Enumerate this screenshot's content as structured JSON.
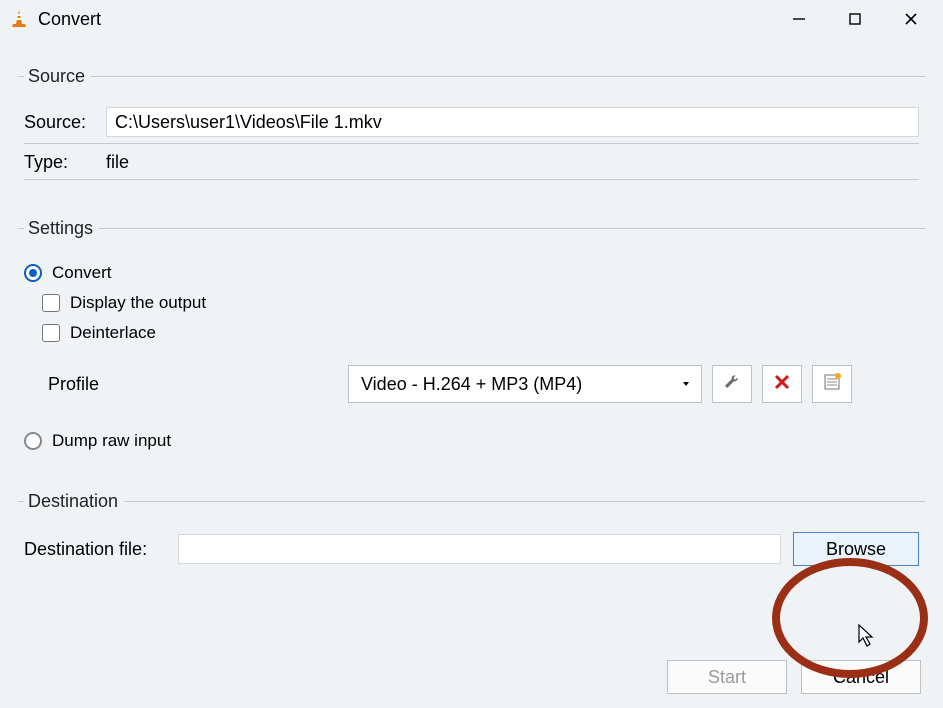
{
  "window": {
    "title": "Convert"
  },
  "source": {
    "legend": "Source",
    "source_label": "Source:",
    "source_value": "C:\\Users\\user1\\Videos\\File 1.mkv",
    "type_label": "Type:",
    "type_value": "file"
  },
  "settings": {
    "legend": "Settings",
    "convert_label": "Convert",
    "display_output_label": "Display the output",
    "deinterlace_label": "Deinterlace",
    "profile_label": "Profile",
    "profile_value": "Video - H.264 + MP3 (MP4)",
    "dump_raw_label": "Dump raw input"
  },
  "destination": {
    "legend": "Destination",
    "dest_label": "Destination file:",
    "dest_value": "",
    "browse_label": "Browse"
  },
  "footer": {
    "start_label": "Start",
    "cancel_label": "Cancel"
  }
}
